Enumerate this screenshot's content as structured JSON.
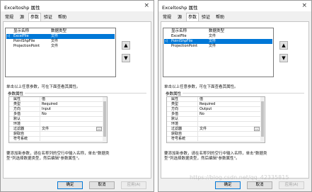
{
  "dialogs": [
    {
      "title": "Exceltoshp 属性",
      "tabs": [
        "常规",
        "源",
        "参数",
        "验证",
        "帮助"
      ],
      "active_tab": 2,
      "columns": [
        "显示名称",
        "数据类型"
      ],
      "params": [
        {
          "name": "ExcelFile",
          "type": "文件",
          "selected": true
        },
        {
          "name": "PointShpFile",
          "type": "文件",
          "selected": false
        },
        {
          "name": "ProjectionPoint",
          "type": "文件",
          "selected": false
        }
      ],
      "hint": "单击以上任意参数，可在下面查看其属性。",
      "group_label": "参数属性",
      "properties": [
        {
          "key": "属性",
          "value": "值"
        },
        {
          "key": "类型",
          "value": "Required"
        },
        {
          "key": "方向",
          "value": "Input"
        },
        {
          "key": "多值",
          "value": "No"
        },
        {
          "key": "默认",
          "value": ""
        },
        {
          "key": "环境",
          "value": ""
        },
        {
          "key": "过滤器",
          "value": "文件"
        },
        {
          "key": "获取自",
          "value": ""
        },
        {
          "key": "符号系统",
          "value": ""
        }
      ],
      "description": "要添加新参数，请在名称列的空行中输入名称，单击\"数据类型\"列选择数据类型，然后编辑\"参数属性\"。",
      "buttons": [
        "确定",
        "取消",
        "应用(A)"
      ]
    },
    {
      "title": "Exceltoshp 属性",
      "tabs": [
        "常规",
        "源",
        "参数",
        "验证",
        "帮助"
      ],
      "active_tab": 2,
      "columns": [
        "显示名称",
        "数据类型"
      ],
      "params": [
        {
          "name": "ExcelFile",
          "type": "文件",
          "selected": false
        },
        {
          "name": "PointShpFile",
          "type": "文件",
          "selected": true
        },
        {
          "name": "ProjectionPoint",
          "type": "文件",
          "selected": false
        }
      ],
      "hint": "单击以上任意参数，可在下面查看其属性。",
      "group_label": "参数属性",
      "properties": [
        {
          "key": "属性",
          "value": "值"
        },
        {
          "key": "类型",
          "value": "Required"
        },
        {
          "key": "方向",
          "value": "Output"
        },
        {
          "key": "多值",
          "value": "No"
        },
        {
          "key": "默认",
          "value": ""
        },
        {
          "key": "环境",
          "value": ""
        },
        {
          "key": "过滤器",
          "value": "文件"
        },
        {
          "key": "获取自",
          "value": ""
        },
        {
          "key": "符号系统",
          "value": ""
        }
      ],
      "description": "要添加新参数，请在名称列的空行中输入名称，单击\"数据类型\"列选择数据类型，然后编辑\"参数属性\"。",
      "buttons": [
        "确定",
        "取消",
        "应用(A)"
      ]
    }
  ],
  "ui": {
    "close_symbol": "×",
    "move_up_symbol": "▲",
    "move_down_symbol": "▼",
    "browse_symbol": "...",
    "selected_marker": "◁"
  },
  "watermark": "https://blog.csdn.net/qq_42335815",
  "colors": {
    "selection": "#0078d7",
    "dialog_bg": "#f0f0f0"
  }
}
